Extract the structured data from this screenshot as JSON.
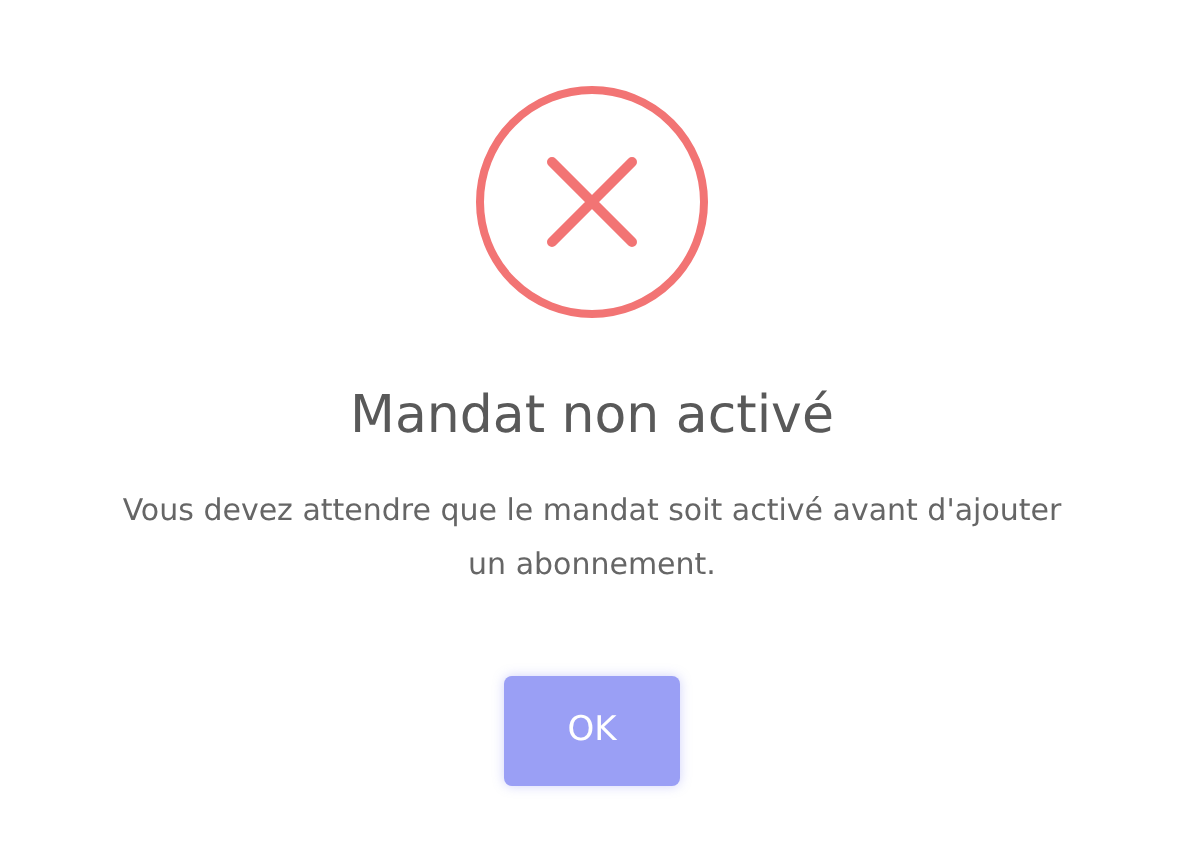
{
  "dialog": {
    "icon": {
      "kind": "error"
    },
    "title": "Mandat non activé",
    "message": "Vous devez attendre que le mandat soit activé avant d'ajouter un abonnement.",
    "buttons": [
      {
        "label": "OK",
        "kind": "confirm"
      }
    ]
  }
}
